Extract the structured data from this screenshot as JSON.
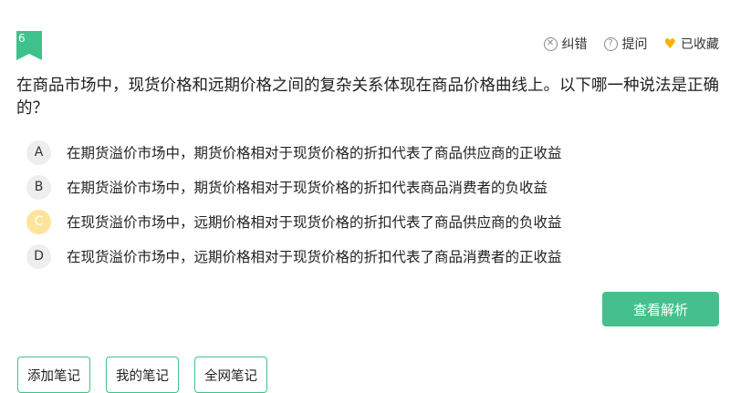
{
  "question": {
    "number": "6",
    "text": "在商品市场中，现货价格和远期价格之间的复杂关系体现在商品价格曲线上。以下哪一种说法是正确的？"
  },
  "actions": {
    "correct_label": "纠错",
    "ask_label": "提问",
    "favorite_label": "已收藏"
  },
  "options": [
    {
      "letter": "A",
      "text": "在期货溢价市场中，期货价格相对于现货价格的折扣代表了商品供应商的正收益"
    },
    {
      "letter": "B",
      "text": "在期货溢价市场中，期货价格相对于现货价格的折扣代表商品消费者的负收益"
    },
    {
      "letter": "C",
      "text": "在现货溢价市场中，远期价格相对于现货价格的折扣代表了商品供应商的负收益"
    },
    {
      "letter": "D",
      "text": "在现货溢价市场中，远期价格相对于现货价格的折扣代表了商品消费者的正收益"
    }
  ],
  "selected_option": "C",
  "view_analysis_label": "查看解析",
  "notes": {
    "add_label": "添加笔记",
    "mine_label": "我的笔记",
    "all_label": "全网笔记"
  },
  "colors": {
    "accent": "#45c08c",
    "selected_option": "#fde49a",
    "favorite": "#f5b300"
  }
}
